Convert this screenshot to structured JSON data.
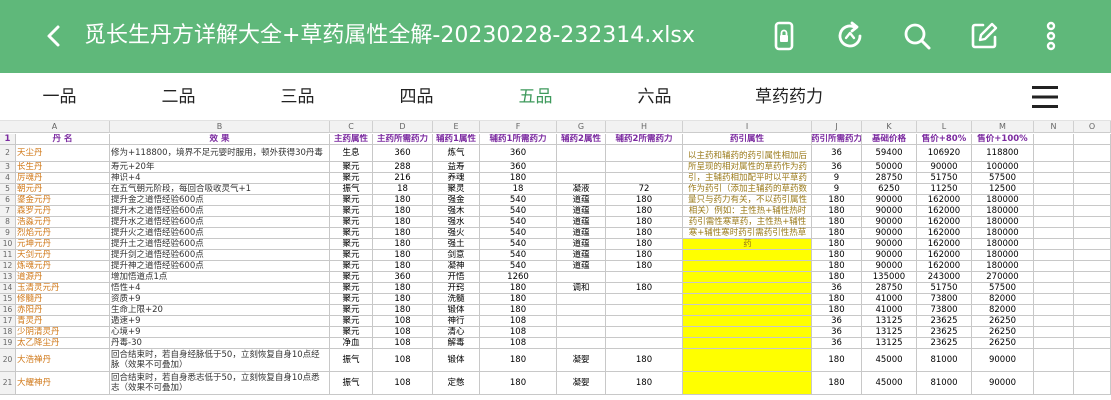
{
  "app": {
    "title": "觅长生丹方详解大全+草药属性全解-20230228-232314.xlsx",
    "accent_color": "#5fb87a",
    "active_tab_color": "#3f9a5c",
    "icons": [
      "back-arrow-icon",
      "phone-lock-icon",
      "refresh-icon",
      "search-icon",
      "edit-icon",
      "more-vertical-icon",
      "menu-icon"
    ]
  },
  "tabs": [
    "一品",
    "二品",
    "三品",
    "四品",
    "五品",
    "六品",
    "草药药力"
  ],
  "active_tab": "五品",
  "sheet": {
    "columns": [
      "A",
      "B",
      "C",
      "D",
      "E",
      "F",
      "G",
      "H",
      "I",
      "J",
      "K",
      "L",
      "M",
      "N",
      "O"
    ],
    "header": [
      "丹  名",
      "效  果",
      "主药属性",
      "主药所需药力",
      "辅药1属性",
      "辅药1所需药力",
      "辅药2属性",
      "辅药2所需药力",
      "药引属性",
      "药引所需药力",
      "基础价格",
      "售价+80%",
      "售价+100%"
    ],
    "note": "以主药和辅药的药引属性相加后所呈现的相对属性的草药作为药引，主辅药相加配平时以平草药作为药引（添加主辅药的草药数量只与药力有关，不以药引属性相关）例如：主性热+辅性热时药引需性寒草药，主性热+辅性寒+辅性寒时药引需药引性热草药",
    "rows": [
      {
        "n": "2",
        "name": "天尘丹",
        "effect": "修为+118800，境界不足元婴时服用，顿外获得30丹毒",
        "c": "生息",
        "d": "360",
        "e": "炼气",
        "f": "360",
        "g": "",
        "h": "",
        "j": "36",
        "k": "59400",
        "l": "106920",
        "m": "118800"
      },
      {
        "n": "3",
        "name": "长生丹",
        "effect": "寿元+20年",
        "c": "聚元",
        "d": "288",
        "e": "益寿",
        "f": "360",
        "g": "",
        "h": "",
        "j": "36",
        "k": "50000",
        "l": "90000",
        "m": "100000"
      },
      {
        "n": "4",
        "name": "厉魂丹",
        "effect": "神识+4",
        "c": "聚元",
        "d": "216",
        "e": "养魂",
        "f": "180",
        "g": "",
        "h": "",
        "j": "9",
        "k": "28750",
        "l": "51750",
        "m": "57500"
      },
      {
        "n": "5",
        "name": "朝元丹",
        "effect": "在五气朝元阶段，每回合吸收灵气+1",
        "c": "振气",
        "d": "18",
        "e": "聚灵",
        "f": "18",
        "g": "凝液",
        "h": "72",
        "j": "9",
        "k": "6250",
        "l": "11250",
        "m": "12500"
      },
      {
        "n": "6",
        "name": "鎏金元丹",
        "effect": "提升金之道悟经验600点",
        "c": "聚元",
        "d": "180",
        "e": "强金",
        "f": "540",
        "g": "道蕴",
        "h": "180",
        "j": "180",
        "k": "90000",
        "l": "162000",
        "m": "180000"
      },
      {
        "n": "7",
        "name": "森罗元丹",
        "effect": "提升木之道悟经验600点",
        "c": "聚元",
        "d": "180",
        "e": "强木",
        "f": "540",
        "g": "道蕴",
        "h": "180",
        "j": "180",
        "k": "90000",
        "l": "162000",
        "m": "180000"
      },
      {
        "n": "8",
        "name": "浩淼元丹",
        "effect": "提升水之道悟经验600点",
        "c": "聚元",
        "d": "180",
        "e": "强水",
        "f": "540",
        "g": "道蕴",
        "h": "180",
        "j": "180",
        "k": "90000",
        "l": "162000",
        "m": "180000"
      },
      {
        "n": "9",
        "name": "烈焰元丹",
        "effect": "提升火之道悟经验600点",
        "c": "聚元",
        "d": "180",
        "e": "强火",
        "f": "540",
        "g": "道蕴",
        "h": "180",
        "j": "180",
        "k": "90000",
        "l": "162000",
        "m": "180000"
      },
      {
        "n": "10",
        "name": "元坤元丹",
        "effect": "提升土之道悟经验600点",
        "c": "聚元",
        "d": "180",
        "e": "强土",
        "f": "540",
        "g": "道蕴",
        "h": "180",
        "j": "180",
        "k": "90000",
        "l": "162000",
        "m": "180000"
      },
      {
        "n": "11",
        "name": "天剑元丹",
        "effect": "提升剑之道悟经验600点",
        "c": "聚元",
        "d": "180",
        "e": "剑意",
        "f": "540",
        "g": "道蕴",
        "h": "180",
        "j": "180",
        "k": "90000",
        "l": "162000",
        "m": "180000"
      },
      {
        "n": "12",
        "name": "炼魂元丹",
        "effect": "提升神之道悟经验600点",
        "c": "聚元",
        "d": "180",
        "e": "凝神",
        "f": "540",
        "g": "道蕴",
        "h": "180",
        "j": "180",
        "k": "90000",
        "l": "162000",
        "m": "180000"
      },
      {
        "n": "13",
        "name": "道源丹",
        "effect": "增加悟道点1点",
        "c": "聚元",
        "d": "360",
        "e": "开悟",
        "f": "1260",
        "g": "",
        "h": "",
        "j": "180",
        "k": "135000",
        "l": "243000",
        "m": "270000"
      },
      {
        "n": "14",
        "name": "玉清灵元丹",
        "effect": "悟性+4",
        "c": "聚元",
        "d": "180",
        "e": "开窍",
        "f": "180",
        "g": "调和",
        "h": "180",
        "j": "36",
        "k": "28750",
        "l": "51750",
        "m": "57500"
      },
      {
        "n": "15",
        "name": "修髓丹",
        "effect": "资质+9",
        "c": "聚元",
        "d": "180",
        "e": "洗髓",
        "f": "180",
        "g": "",
        "h": "",
        "j": "180",
        "k": "41000",
        "l": "73800",
        "m": "82000"
      },
      {
        "n": "16",
        "name": "赤阳丹",
        "effect": "生命上限+20",
        "c": "聚元",
        "d": "180",
        "e": "锻体",
        "f": "180",
        "g": "",
        "h": "",
        "j": "180",
        "k": "41000",
        "l": "73800",
        "m": "82000"
      },
      {
        "n": "17",
        "name": "青灵丹",
        "effect": "遁速+9",
        "c": "聚元",
        "d": "108",
        "e": "神行",
        "f": "108",
        "g": "",
        "h": "",
        "j": "36",
        "k": "13125",
        "l": "23625",
        "m": "26250"
      },
      {
        "n": "18",
        "name": "少阴清灵丹",
        "effect": "心境+9",
        "c": "聚元",
        "d": "108",
        "e": "清心",
        "f": "108",
        "g": "",
        "h": "",
        "j": "36",
        "k": "13125",
        "l": "23625",
        "m": "26250"
      },
      {
        "n": "19",
        "name": "太乙降尘丹",
        "effect": "丹毒-30",
        "c": "净血",
        "d": "108",
        "e": "解毒",
        "f": "108",
        "g": "",
        "h": "",
        "j": "36",
        "k": "13125",
        "l": "23625",
        "m": "26250"
      },
      {
        "n": "20",
        "name": "大浩禅丹",
        "effect": "回合结束时，若自身经脉低于50，立刻恢复自身10点经脉（效果不可叠加）",
        "c": "振气",
        "d": "108",
        "e": "锻体",
        "f": "180",
        "g": "凝婴",
        "h": "180",
        "j": "180",
        "k": "45000",
        "l": "81000",
        "m": "90000"
      },
      {
        "n": "21",
        "name": "大耀神丹",
        "effect": "回合结束时，若自身悉志低于50，立刻恢复自身10点悉志（效果不可叠加）",
        "c": "振气",
        "d": "108",
        "e": "定憋",
        "f": "180",
        "g": "凝婴",
        "h": "180",
        "j": "180",
        "k": "45000",
        "l": "81000",
        "m": "90000"
      }
    ]
  }
}
